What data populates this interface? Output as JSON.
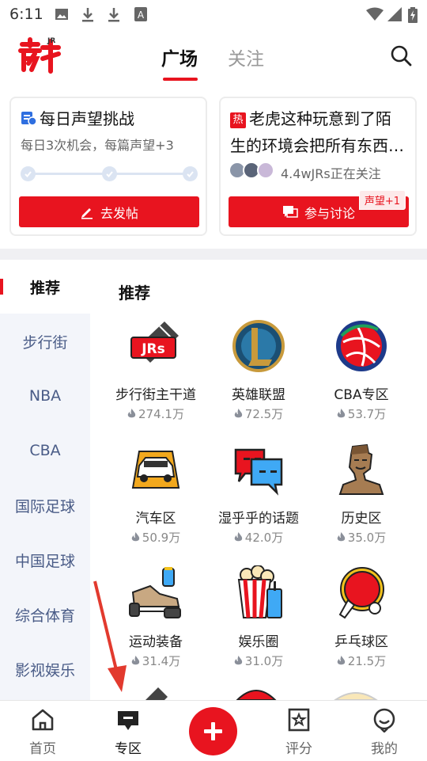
{
  "status_bar": {
    "time": "6:11"
  },
  "header": {
    "tabs": [
      {
        "label": "广场"
      },
      {
        "label": "关注"
      }
    ],
    "brand_color": "#e8141f"
  },
  "cards": [
    {
      "title": "每日声望挑战",
      "subtitle": "每日3次机会，每篇声望+3",
      "button_label": "去发帖"
    },
    {
      "hot_badge": "热",
      "title_line1": "老虎这种玩意到了陌",
      "title_line2": "生的环境会把所有东西…",
      "followers_text": "4.4wJRs正在关注",
      "button_label": "参与讨论",
      "reward_tag": "声望+1"
    }
  ],
  "sidebar": {
    "items": [
      {
        "label": "推荐"
      },
      {
        "label": "步行街"
      },
      {
        "label": "NBA"
      },
      {
        "label": "CBA"
      },
      {
        "label": "国际足球"
      },
      {
        "label": "中国足球"
      },
      {
        "label": "综合体育"
      },
      {
        "label": "影视娱乐"
      }
    ]
  },
  "main": {
    "section_title": "推荐",
    "zones": [
      {
        "name": "步行街主干道",
        "heat": "274.1万",
        "icon": "jrs-icon"
      },
      {
        "name": "英雄联盟",
        "heat": "72.5万",
        "icon": "league-of-legends-icon"
      },
      {
        "name": "CBA专区",
        "heat": "53.7万",
        "icon": "cba-icon"
      },
      {
        "name": "汽车区",
        "heat": "50.9万",
        "icon": "car-icon"
      },
      {
        "name": "湿乎乎的话题",
        "heat": "42.0万",
        "icon": "chat-bubbles-icon"
      },
      {
        "name": "历史区",
        "heat": "35.0万",
        "icon": "terracotta-warrior-icon"
      },
      {
        "name": "运动装备",
        "heat": "31.4万",
        "icon": "sneaker-icon"
      },
      {
        "name": "娱乐圈",
        "heat": "31.0万",
        "icon": "popcorn-icon"
      },
      {
        "name": "乒乓球区",
        "heat": "21.5万",
        "icon": "ping-pong-icon"
      }
    ]
  },
  "bottom_nav": {
    "items": [
      {
        "label": "首页",
        "icon": "home-icon"
      },
      {
        "label": "专区",
        "icon": "zone-icon"
      },
      {
        "label": "",
        "icon": "plus-icon"
      },
      {
        "label": "评分",
        "icon": "rating-icon"
      },
      {
        "label": "我的",
        "icon": "profile-icon"
      }
    ]
  }
}
